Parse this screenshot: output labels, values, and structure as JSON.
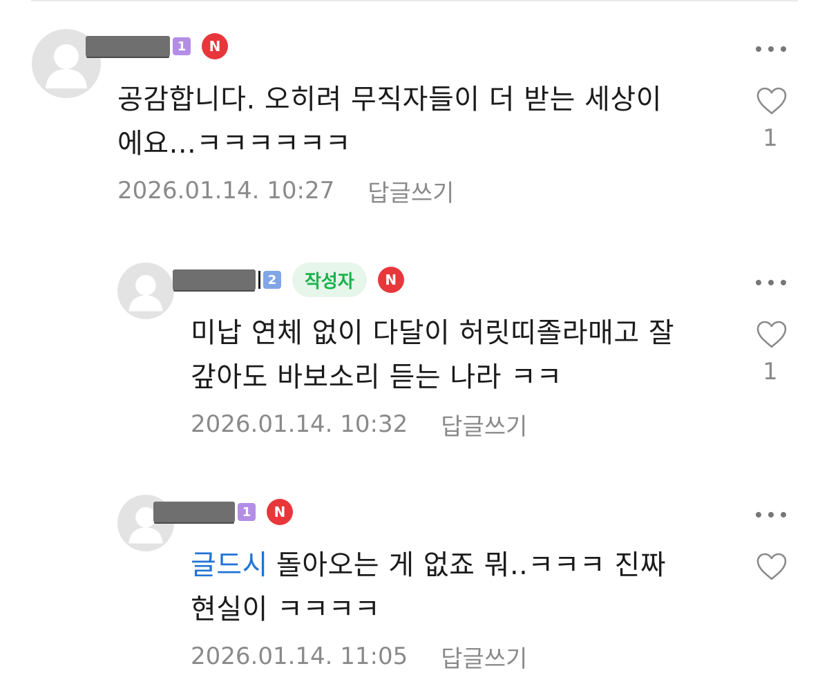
{
  "comments": [
    {
      "level": "1",
      "new_badge": "N",
      "text": "공감합니다. 오히려 무직자들이 더 받는 세상이\n에요...ㅋㅋㅋㅋㅋㅋ",
      "text_line1": "공감합니다. 오히려 무직자들이 더 받는 세상이",
      "text_line2": "에요...ㅋㅋㅋㅋㅋㅋ",
      "timestamp": "2026.01.14. 10:27",
      "reply_label": "답글쓰기",
      "like_count": "1",
      "more_icon": "more-dots-icon",
      "like_icon": "heart-outline-icon"
    },
    {
      "level": "2",
      "author_badge": "작성자",
      "new_badge": "N",
      "text_line1": "미납 연체 없이 다달이 허릿띠졸라매고 잘",
      "text_line2": "갚아도 바보소리 듣는 나라 ㅋㅋ",
      "timestamp": "2026.01.14. 10:32",
      "reply_label": "답글쓰기",
      "like_count": "1"
    },
    {
      "level": "1",
      "new_badge": "N",
      "mention": "글드시",
      "text_line1": "돌아오는 게 없죠 뭐..ㅋㅋㅋ 진짜",
      "text_line2": "현실이 ㅋㅋㅋㅋ",
      "timestamp": "2026.01.14. 11:05",
      "reply_label": "답글쓰기"
    }
  ],
  "colors": {
    "mention": "#1f73d6",
    "author_badge_text": "#19b14b",
    "author_badge_bg": "#e6f6ea",
    "new_badge": "#e8373b",
    "level1_badge": "#b48ee6",
    "level2_badge": "#7fa6e6",
    "meta_text": "#8a8a8a"
  }
}
